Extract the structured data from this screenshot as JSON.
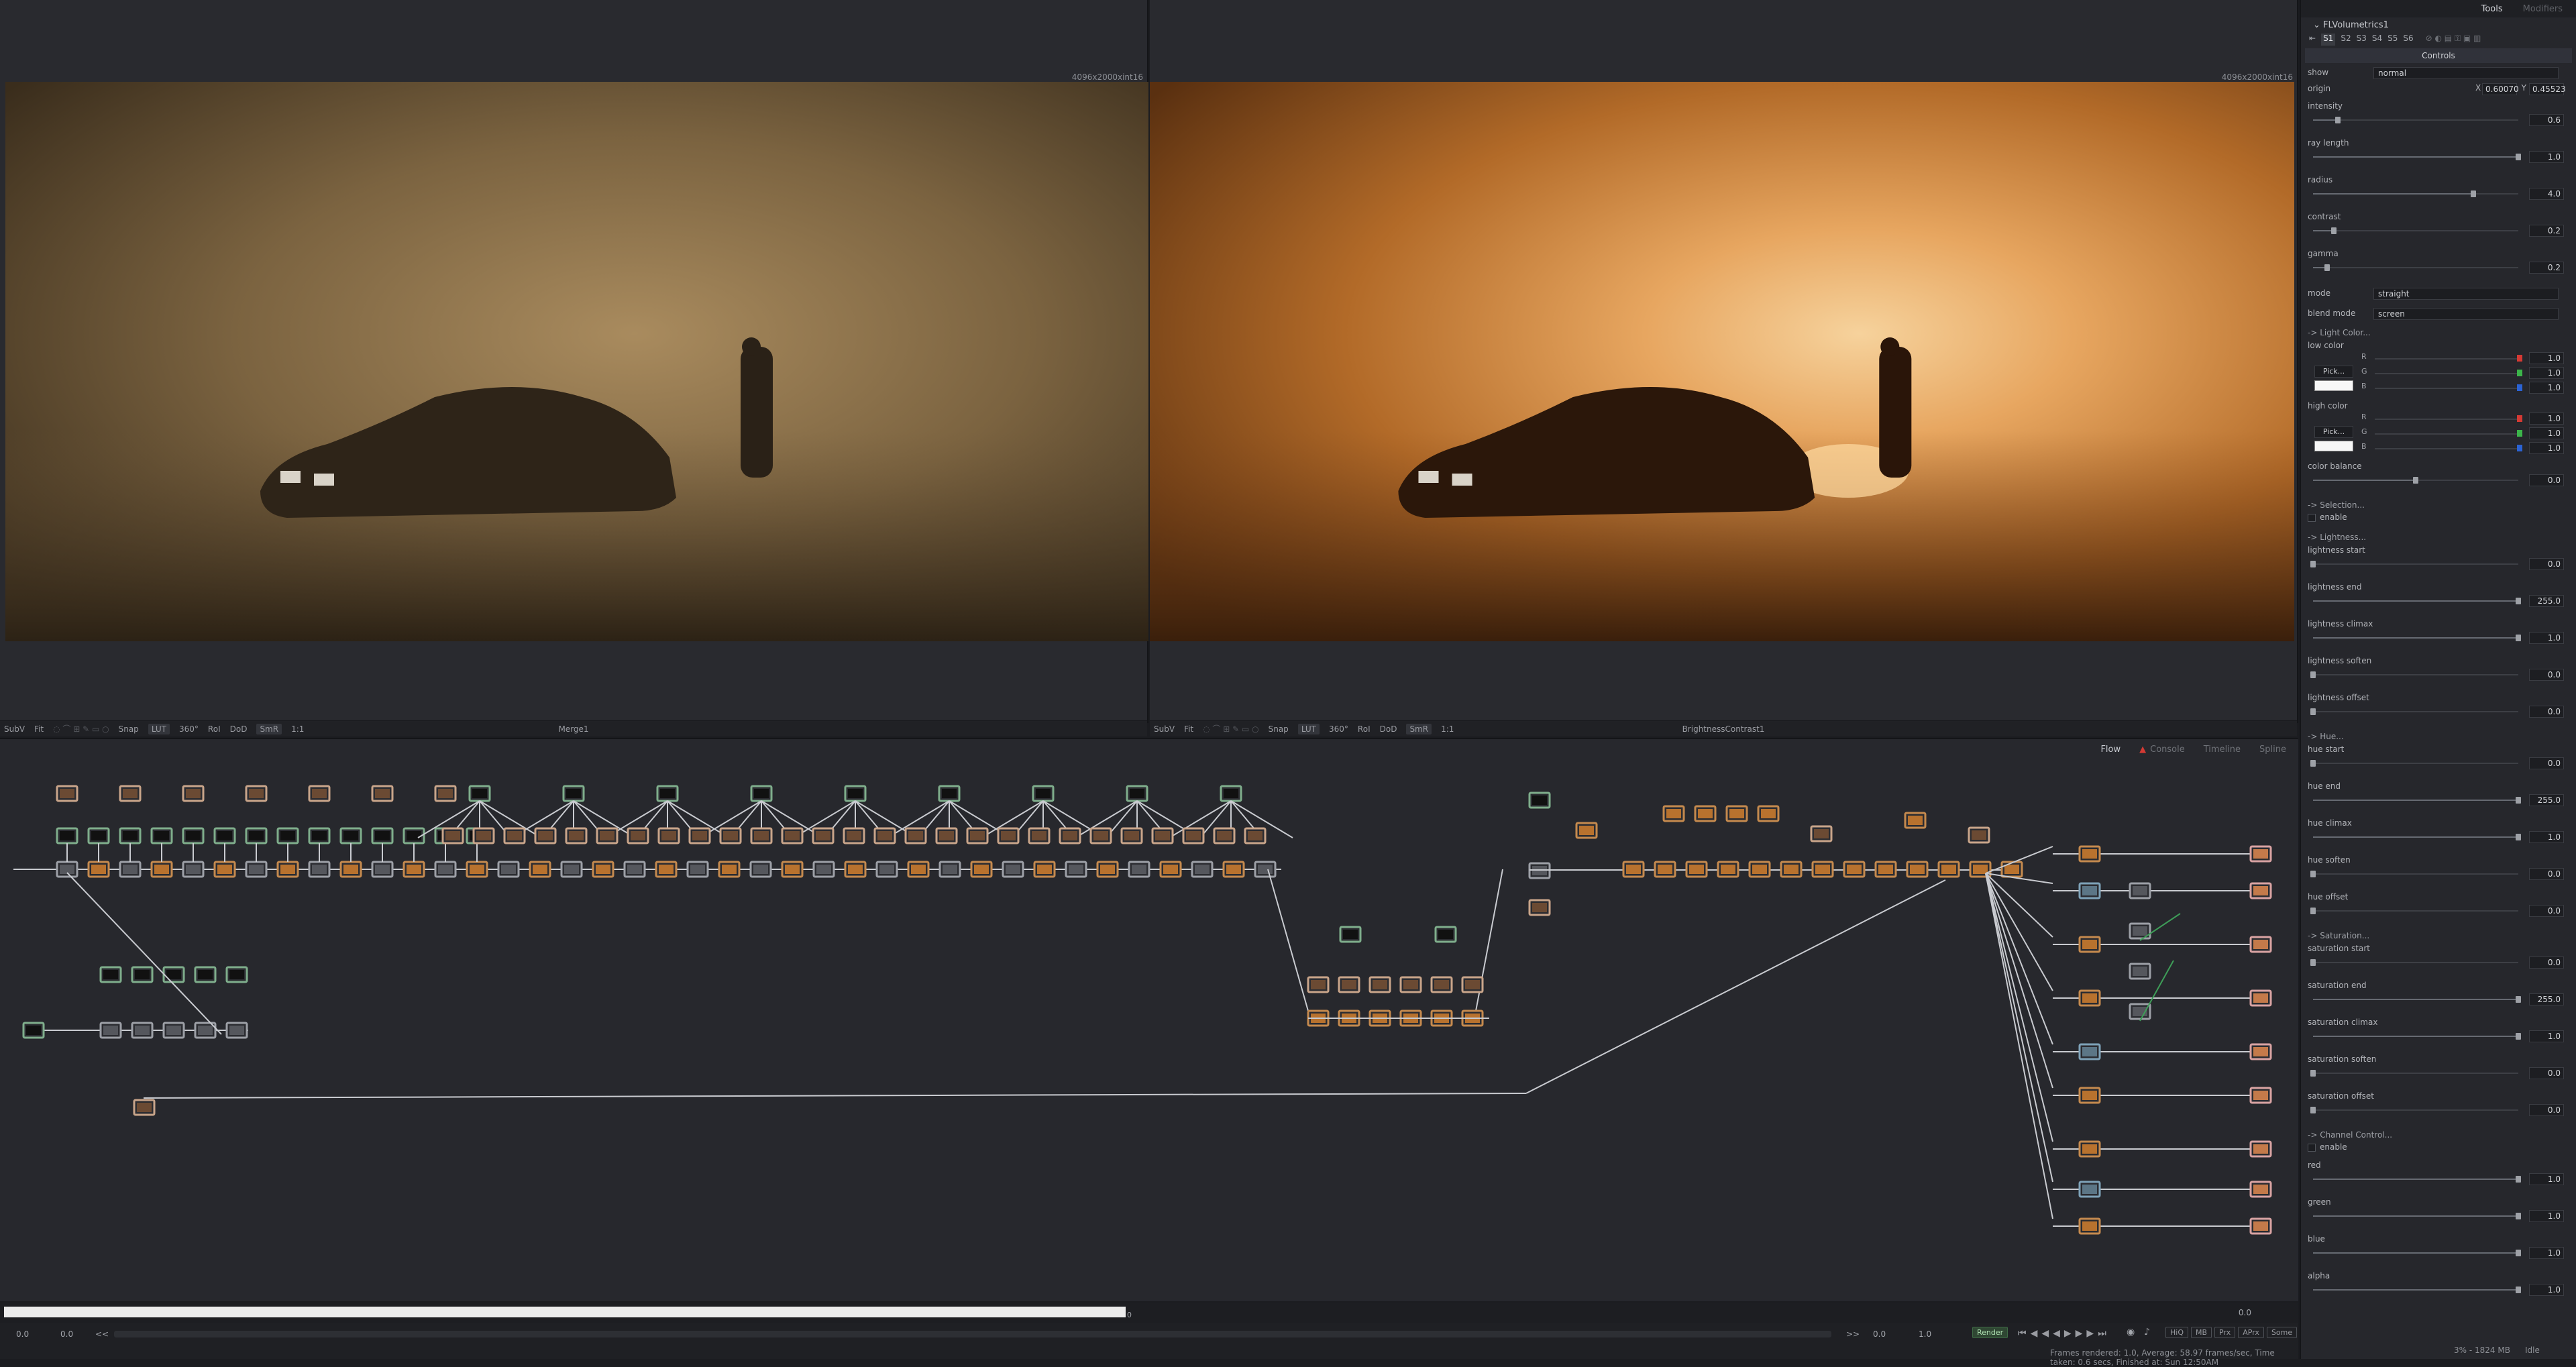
{
  "viewers": {
    "left": {
      "resolution": "4096x2000xint16",
      "node": "Merge1",
      "toolbar": [
        "SubV",
        "Fit",
        "LUT",
        "360°",
        "RoI",
        "DoD",
        "Snap",
        "SmR",
        "1:1"
      ]
    },
    "right": {
      "resolution": "4096x2000xint16",
      "node": "BrightnessContrast1",
      "toolbar": [
        "SubV",
        "Fit",
        "LUT",
        "360°",
        "RoI",
        "DoD",
        "Snap",
        "SmR",
        "1:1"
      ]
    }
  },
  "flow_tabs": [
    "Flow",
    "Console",
    "Timeline",
    "Spline"
  ],
  "ruler": {
    "right_value": "0.0",
    "marker_value": "0"
  },
  "transport": {
    "start": "0.0",
    "start2": "0.0",
    "nav_left": "<<",
    "nav_right": ">>",
    "end": "0.0",
    "end2": "1.0",
    "render_label": "Render",
    "buttons": [
      "HiQ",
      "MB",
      "Prx",
      "APrx",
      "Some"
    ]
  },
  "status": {
    "frames": "Frames rendered: 1.0, Average: 58.97 frames/sec, Time taken: 0.6 secs, Finished at: Sun 12:50AM",
    "memory": "3% - 1824 MB",
    "state": "Idle"
  },
  "inspector": {
    "tabs": [
      "Tools",
      "Modifiers"
    ],
    "node_name": "FLVolumetrics1",
    "subtabs": [
      "S1",
      "S2",
      "S3",
      "S4",
      "S5",
      "S6"
    ],
    "controls_label": "Controls",
    "show": {
      "label": "show",
      "value": "normal"
    },
    "origin": {
      "label": "origin",
      "x_label": "X",
      "x": "0.60070",
      "y_label": "Y",
      "y": "0.45523"
    },
    "sliders_top": [
      {
        "label": "intensity",
        "value": "0.6",
        "frac": 0.12
      },
      {
        "label": "ray length",
        "value": "1.0",
        "frac": 1.0
      },
      {
        "label": "radius",
        "value": "4.0",
        "frac": 0.78
      },
      {
        "label": "contrast",
        "value": "0.2",
        "frac": 0.1
      },
      {
        "label": "gamma",
        "value": "0.2",
        "frac": 0.07
      }
    ],
    "mode": {
      "label": "mode",
      "value": "straight"
    },
    "blend_mode": {
      "label": "blend mode",
      "value": "screen"
    },
    "light_color_section": "-> Light Color...",
    "low_color": {
      "label": "low color",
      "pick": "Pick...",
      "r": "1.0",
      "g": "1.0",
      "b": "1.0"
    },
    "high_color": {
      "label": "high color",
      "pick": "Pick...",
      "r": "1.0",
      "g": "1.0",
      "b": "1.0"
    },
    "color_balance": {
      "label": "color balance",
      "value": "0.0",
      "frac": 0.5
    },
    "selection_section": "-> Selection...",
    "selection_enable": "enable",
    "lightness_section": "-> Lightness...",
    "lightness": [
      {
        "label": "lightness start",
        "value": "0.0",
        "frac": 0.0
      },
      {
        "label": "lightness end",
        "value": "255.0",
        "frac": 1.0
      },
      {
        "label": "lightness climax",
        "value": "1.0",
        "frac": 1.0
      },
      {
        "label": "lightness soften",
        "value": "0.0",
        "frac": 0.0
      },
      {
        "label": "lightness offset",
        "value": "0.0",
        "frac": 0.0
      }
    ],
    "hue_section": "-> Hue...",
    "hue": [
      {
        "label": "hue start",
        "value": "0.0",
        "frac": 0.0
      },
      {
        "label": "hue end",
        "value": "255.0",
        "frac": 1.0
      },
      {
        "label": "hue climax",
        "value": "1.0",
        "frac": 1.0
      },
      {
        "label": "hue soften",
        "value": "0.0",
        "frac": 0.0
      },
      {
        "label": "hue offset",
        "value": "0.0",
        "frac": 0.0
      }
    ],
    "saturation_section": "-> Saturation...",
    "saturation": [
      {
        "label": "saturation start",
        "value": "0.0",
        "frac": 0.0
      },
      {
        "label": "saturation end",
        "value": "255.0",
        "frac": 1.0
      },
      {
        "label": "saturation climax",
        "value": "1.0",
        "frac": 1.0
      },
      {
        "label": "saturation soften",
        "value": "0.0",
        "frac": 0.0
      },
      {
        "label": "saturation offset",
        "value": "0.0",
        "frac": 0.0
      }
    ],
    "channel_section": "-> Channel Control...",
    "channel_enable": "enable",
    "channels": [
      {
        "label": "red",
        "value": "1.0",
        "frac": 1.0
      },
      {
        "label": "green",
        "value": "1.0",
        "frac": 1.0
      },
      {
        "label": "blue",
        "value": "1.0",
        "frac": 1.0
      },
      {
        "label": "alpha",
        "value": "1.0",
        "frac": 1.0
      }
    ]
  },
  "colors": {
    "accent_green": "#7fae8c",
    "render_green": "#3f6a45",
    "warning_red": "#d43a34"
  }
}
